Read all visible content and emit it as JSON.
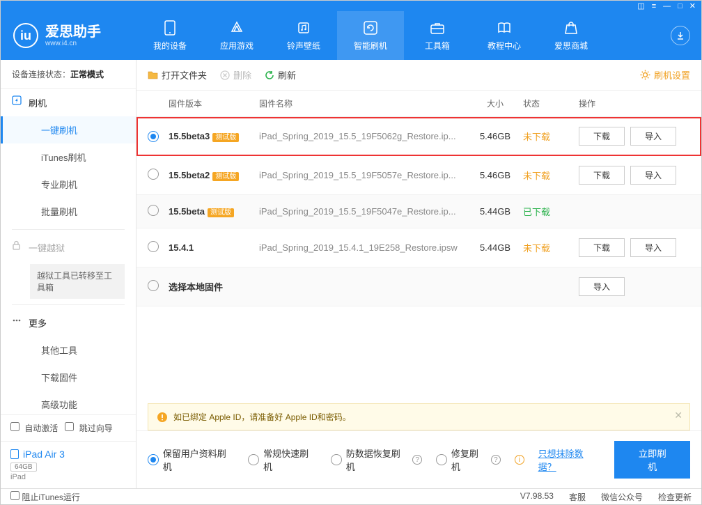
{
  "titlebar": {
    "icons": [
      "◰",
      "≡",
      "—",
      "□",
      "✕"
    ]
  },
  "logo": {
    "mark": "iu",
    "title": "爱思助手",
    "url": "www.i4.cn"
  },
  "nav": [
    {
      "label": "我的设备"
    },
    {
      "label": "应用游戏"
    },
    {
      "label": "铃声壁纸"
    },
    {
      "label": "智能刷机"
    },
    {
      "label": "工具箱"
    },
    {
      "label": "教程中心"
    },
    {
      "label": "爱思商城"
    }
  ],
  "sidebar": {
    "conn_prefix": "设备连接状态：",
    "conn_value": "正常模式",
    "group_flash": "刷机",
    "items": [
      "一键刷机",
      "iTunes刷机",
      "专业刷机",
      "批量刷机"
    ],
    "group_jb": "一键越狱",
    "jb_note": "越狱工具已转移至工具箱",
    "group_more": "更多",
    "more_items": [
      "其他工具",
      "下载固件",
      "高级功能"
    ],
    "auto_activate": "自动激活",
    "skip_guide": "跳过向导",
    "device_name": "iPad Air 3",
    "device_cap": "64GB",
    "device_type": "iPad"
  },
  "toolbar": {
    "open": "打开文件夹",
    "delete": "删除",
    "refresh": "刷新",
    "settings": "刷机设置"
  },
  "columns": {
    "version": "固件版本",
    "name": "固件名称",
    "size": "大小",
    "status": "状态",
    "action": "操作"
  },
  "badge_beta": "测试版",
  "rows": [
    {
      "ver": "15.5beta3",
      "beta": true,
      "name": "iPad_Spring_2019_15.5_19F5062g_Restore.ip...",
      "size": "5.46GB",
      "status": "未下载",
      "status_cls": "und",
      "selected": true,
      "buttons": [
        "下载",
        "导入"
      ],
      "highlight": true
    },
    {
      "ver": "15.5beta2",
      "beta": true,
      "name": "iPad_Spring_2019_15.5_19F5057e_Restore.ip...",
      "size": "5.46GB",
      "status": "未下载",
      "status_cls": "und",
      "selected": false,
      "buttons": [
        "下载",
        "导入"
      ]
    },
    {
      "ver": "15.5beta",
      "beta": true,
      "name": "iPad_Spring_2019_15.5_19F5047e_Restore.ip...",
      "size": "5.44GB",
      "status": "已下载",
      "status_cls": "done",
      "selected": false,
      "buttons": [],
      "alt": true
    },
    {
      "ver": "15.4.1",
      "beta": false,
      "name": "iPad_Spring_2019_15.4.1_19E258_Restore.ipsw",
      "size": "5.44GB",
      "status": "未下载",
      "status_cls": "und",
      "selected": false,
      "buttons": [
        "下载",
        "导入"
      ]
    },
    {
      "ver": "选择本地固件",
      "beta": false,
      "name": "",
      "size": "",
      "status": "",
      "status_cls": "",
      "selected": false,
      "buttons": [
        "导入"
      ],
      "alt": true
    }
  ],
  "notice": "如已绑定 Apple ID，请准备好 Apple ID和密码。",
  "flash": {
    "opts": [
      "保留用户资料刷机",
      "常规快速刷机",
      "防数据恢复刷机",
      "修复刷机"
    ],
    "erase_link": "只想抹除数据？",
    "go": "立即刷机"
  },
  "footer": {
    "block_itunes": "阻止iTunes运行",
    "version": "V7.98.53",
    "svc": "客服",
    "wechat": "微信公众号",
    "update": "检查更新"
  }
}
